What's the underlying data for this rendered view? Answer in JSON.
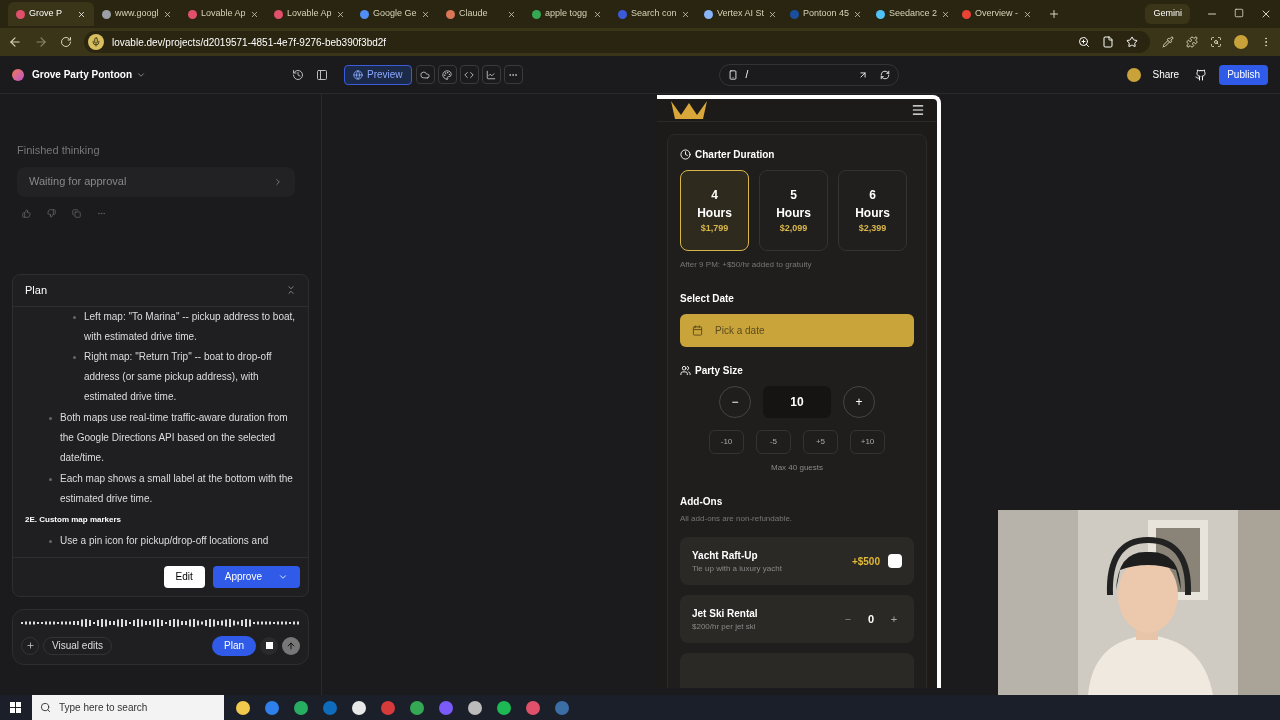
{
  "browser": {
    "tabs": [
      {
        "title": "Grove P",
        "selected": true,
        "color": "#e0506a"
      },
      {
        "title": "www.googl",
        "selected": false,
        "color": "#9aa0a6"
      },
      {
        "title": "Lovable Ap",
        "selected": false,
        "color": "#e0506a"
      },
      {
        "title": "Lovable Ap",
        "selected": false,
        "color": "#e0506a"
      },
      {
        "title": "Google Ge",
        "selected": false,
        "color": "#4f8ff7"
      },
      {
        "title": "Claude",
        "selected": false,
        "color": "#d97757"
      },
      {
        "title": "apple togg",
        "selected": false,
        "color": "#34a853"
      },
      {
        "title": "Search con",
        "selected": false,
        "color": "#3b5bdb"
      },
      {
        "title": "Vertex AI St",
        "selected": false,
        "color": "#8ab4f8"
      },
      {
        "title": "Pontoon 45",
        "selected": false,
        "color": "#1a4fa0"
      },
      {
        "title": "Seedance 2",
        "selected": false,
        "color": "#4fc3f7"
      },
      {
        "title": "Overview -",
        "selected": false,
        "color": "#ea4335"
      }
    ],
    "gemini": "Gemini",
    "url": "lovable.dev/projects/d2019571-4851-4e7f-9276-beb390f3bd2f"
  },
  "app": {
    "project": "Grove Party Pontoon",
    "preview": "Preview",
    "path": "/",
    "share": "Share",
    "publish": "Publish"
  },
  "chat": {
    "status": "Finished thinking",
    "approval": "Waiting for approval",
    "plan": {
      "title": "Plan",
      "blocks": [
        {
          "kind": "subbullets",
          "items": [
            "Left map: \"To Marina\" -- pickup address to boat, with estimated drive time.",
            "Right map: \"Return Trip\" -- boat to drop-off address (or same pickup address), with estimated drive time."
          ]
        },
        {
          "kind": "bullet",
          "text": "Both maps use real-time traffic-aware duration from the Google Directions API based on the selected date/time."
        },
        {
          "kind": "bullet",
          "text": "Each map shows a small label at the bottom with the estimated drive time."
        },
        {
          "kind": "heading",
          "text": "2E. Custom map markers"
        },
        {
          "kind": "bullet",
          "text": "Use a pin icon for pickup/drop-off locations and"
        }
      ],
      "edit": "Edit",
      "approve": "Approve"
    },
    "visual_edits": "Visual edits",
    "mode": "Plan"
  },
  "site": {
    "duration": {
      "title": "Charter Duration",
      "options": [
        {
          "number": "4",
          "unit": "Hours",
          "price": "$1,799",
          "selected": true
        },
        {
          "number": "5",
          "unit": "Hours",
          "price": "$2,099",
          "selected": false
        },
        {
          "number": "6",
          "unit": "Hours",
          "price": "$2,399",
          "selected": false
        }
      ],
      "note": "After 9 PM: +$50/hr added to gratuity"
    },
    "date": {
      "title": "Select Date",
      "placeholder": "Pick a date"
    },
    "party": {
      "title": "Party Size",
      "minus": "−",
      "value": "10",
      "plus": "+",
      "quick": [
        "-10",
        "-5",
        "+5",
        "+10"
      ],
      "max": "Max 40 guests"
    },
    "addons": {
      "title": "Add-Ons",
      "note": "All add-ons are non-refundable.",
      "items": [
        {
          "kind": "toggle",
          "name": "Yacht Raft-Up",
          "desc": "Tie up with a luxury yacht",
          "price": "+$500",
          "checked": false
        },
        {
          "kind": "counter",
          "name": "Jet Ski Rental",
          "desc": "$200/hr per jet ski",
          "minus": "−",
          "count": "0",
          "plus": "+"
        }
      ]
    }
  },
  "taskbar": {
    "search": "Type here to search"
  }
}
